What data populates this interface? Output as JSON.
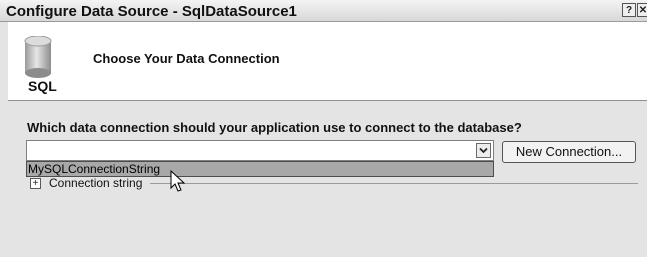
{
  "window": {
    "title": "Configure Data Source - SqlDataSource1",
    "help_glyph": "?",
    "close_glyph": "✕"
  },
  "header": {
    "icon_label": "SQL",
    "heading": "Choose Your Data Connection"
  },
  "connection": {
    "question": "Which data connection should your application use to connect to the database?",
    "selected_value": "",
    "new_connection_label": "New Connection...",
    "dropdown_options": [
      "MySQLConnectionString"
    ]
  },
  "details": {
    "expand_glyph": "+",
    "connection_string_label": "Connection string"
  },
  "icons": {
    "database": "database-cylinder-icon",
    "dropdown": "chevron-down-icon",
    "expand": "plus-box-icon",
    "cursor": "mouse-pointer-icon"
  },
  "colors": {
    "background": "#e4e4e4",
    "header_background": "#ffffff",
    "dropdown_highlight": "#a8a8a8"
  }
}
